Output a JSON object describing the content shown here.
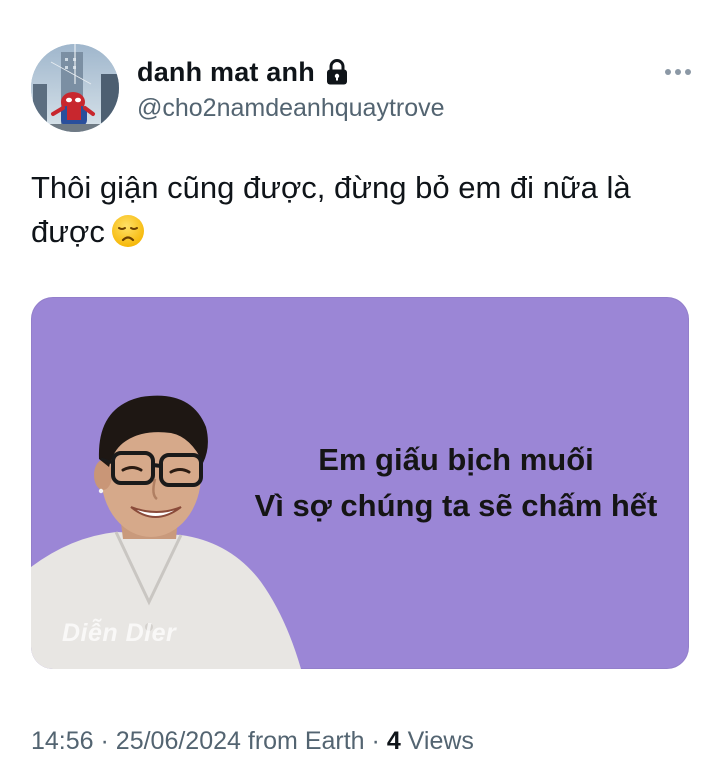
{
  "author": {
    "display_name": "danh mat anh",
    "handle": "@cho2namdeanhquaytrove",
    "avatar_icon": "spiderman-avatar",
    "protected_icon": "lock-icon"
  },
  "header": {
    "more_icon": "more-dots-icon"
  },
  "tweet": {
    "text_line1": "Thôi giận cũng được, đừng bỏ em đi nữa là",
    "text_line2": "được",
    "emoji": "disappointed-face-emoji"
  },
  "media": {
    "caption_line1": "Em giấu bịch muối",
    "caption_line2": "Vì sợ chúng ta sẽ chấm hết",
    "watermark": "Diễn Dler",
    "background_color": "#9b86d6"
  },
  "meta": {
    "time": "14:56",
    "separator": "·",
    "date": "25/06/2024",
    "source": "from Earth",
    "views_count": "4",
    "views_label": "Views"
  },
  "colors": {
    "text_primary": "#0f1419",
    "text_secondary": "#536471"
  }
}
